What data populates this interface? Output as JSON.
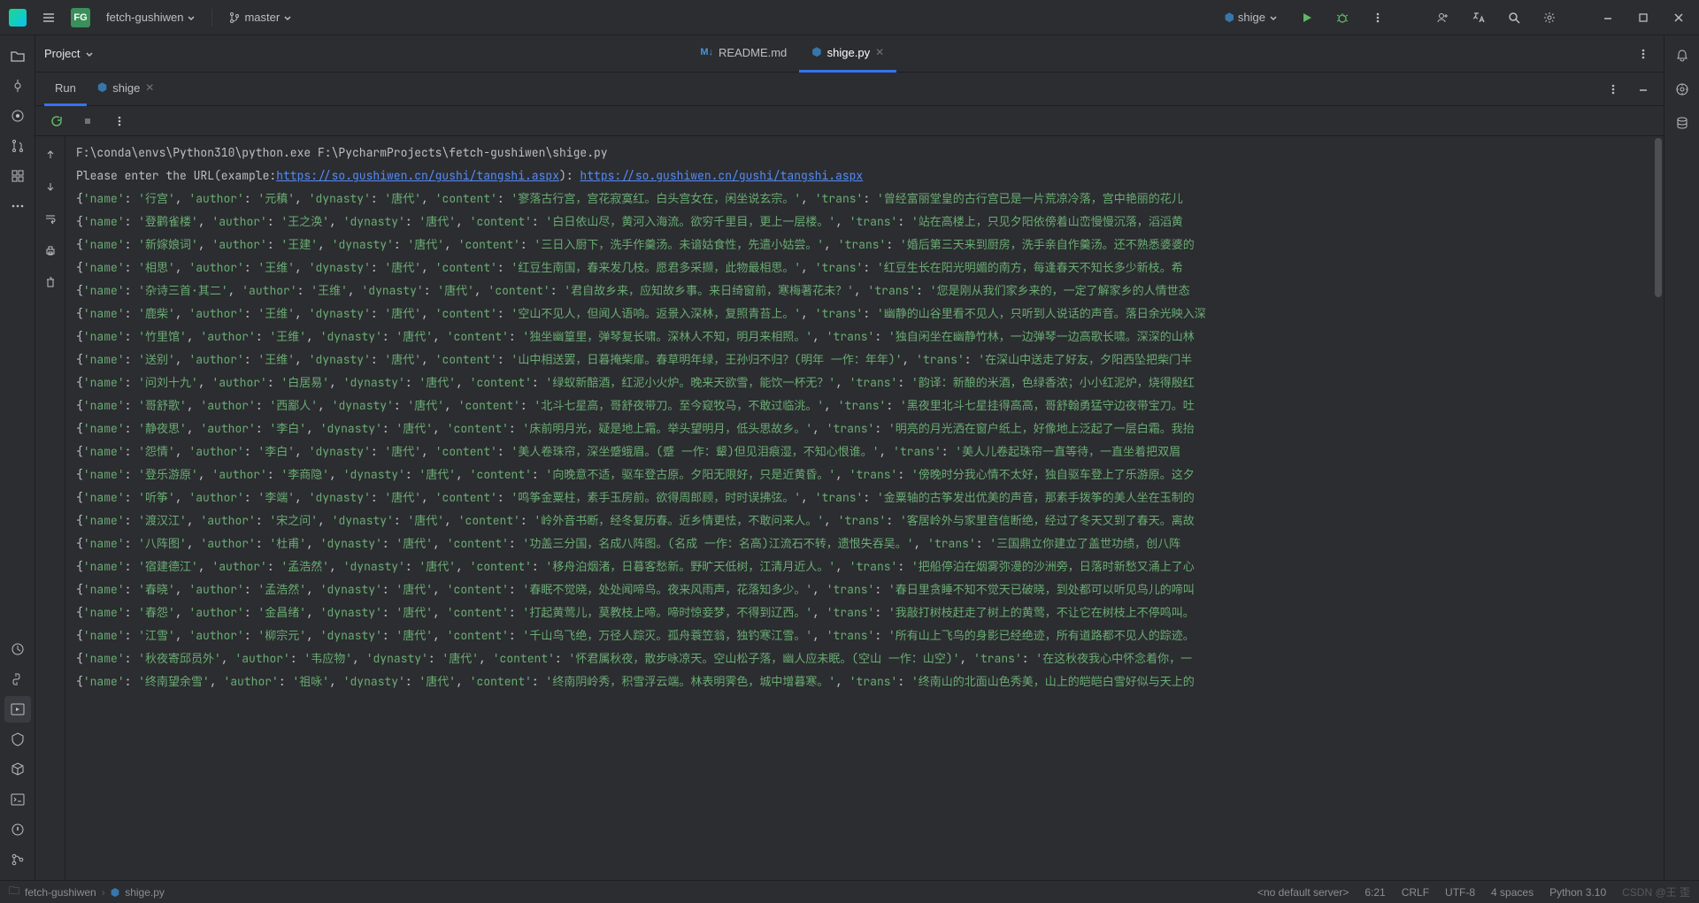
{
  "titlebar": {
    "project_badge": "FG",
    "project_name": "fetch-gushiwen",
    "branch": "master",
    "run_config": "shige"
  },
  "project_panel_label": "Project",
  "tabs": [
    {
      "label": "README.md",
      "icon": "md"
    },
    {
      "label": "shige.py",
      "icon": "py",
      "active": true
    }
  ],
  "run_tab": {
    "label": "Run",
    "config": "shige"
  },
  "console": {
    "exec_line": "F:\\conda\\envs\\Python310\\python.exe F:\\PycharmProjects\\fetch-gushiwen\\shige.py",
    "prompt_prefix": "Please enter the URL(example:",
    "example_url": "https://so.gushiwen.cn/gushi/tangshi.aspx",
    "prompt_suffix": "): ",
    "entered_url": "https://so.gushiwen.cn/gushi/tangshi.aspx",
    "rows": [
      {
        "name": "行宫",
        "author": "元稹",
        "dynasty": "唐代",
        "content": "寥落古行宫，宫花寂寞红。白头宫女在，闲坐说玄宗。",
        "trans": "曾经富丽堂皇的古行宫已是一片荒凉冷落，宫中艳丽的花儿"
      },
      {
        "name": "登鹳雀楼",
        "author": "王之涣",
        "dynasty": "唐代",
        "content": "白日依山尽，黄河入海流。欲穷千里目，更上一层楼。",
        "trans": "站在高楼上，只见夕阳依傍着山峦慢慢沉落，滔滔黄"
      },
      {
        "name": "新嫁娘词",
        "author": "王建",
        "dynasty": "唐代",
        "content": "三日入厨下，洗手作羹汤。未谙姑食性，先遣小姑尝。",
        "trans": "婚后第三天来到厨房，洗手亲自作羹汤。还不熟悉婆婆的"
      },
      {
        "name": "相思",
        "author": "王维",
        "dynasty": "唐代",
        "content": "红豆生南国，春来发几枝。愿君多采撷，此物最相思。",
        "trans": "红豆生长在阳光明媚的南方，每逢春天不知长多少新枝。希"
      },
      {
        "name": "杂诗三首·其二",
        "author": "王维",
        "dynasty": "唐代",
        "content": "君自故乡来，应知故乡事。来日绮窗前，寒梅著花未？",
        "trans": "您是刚从我们家乡来的，一定了解家乡的人情世态"
      },
      {
        "name": "鹿柴",
        "author": "王维",
        "dynasty": "唐代",
        "content": "空山不见人，但闻人语响。返景入深林，复照青苔上。",
        "trans": "幽静的山谷里看不见人，只听到人说话的声音。落日余光映入深"
      },
      {
        "name": "竹里馆",
        "author": "王维",
        "dynasty": "唐代",
        "content": "独坐幽篁里，弹琴复长啸。深林人不知，明月来相照。",
        "trans": "独自闲坐在幽静竹林，一边弹琴一边高歌长啸。深深的山林"
      },
      {
        "name": "送别",
        "author": "王维",
        "dynasty": "唐代",
        "content": "山中相送罢，日暮掩柴扉。春草明年绿，王孙归不归？(明年 一作：年年)",
        "trans": "在深山中送走了好友，夕阳西坠把柴门半"
      },
      {
        "name": "问刘十九",
        "author": "白居易",
        "dynasty": "唐代",
        "content": "绿蚁新醅酒，红泥小火炉。晚来天欲雪，能饮一杯无？",
        "trans": "韵译：新酿的米酒，色绿香浓；小小红泥炉，烧得殷红"
      },
      {
        "name": "哥舒歌",
        "author": "西鄙人",
        "dynasty": "唐代",
        "content": "北斗七星高，哥舒夜带刀。至今窥牧马，不敢过临洮。",
        "trans": "黑夜里北斗七星挂得高高，哥舒翰勇猛守边夜带宝刀。吐"
      },
      {
        "name": "静夜思",
        "author": "李白",
        "dynasty": "唐代",
        "content": "床前明月光，疑是地上霜。举头望明月，低头思故乡。",
        "trans": "明亮的月光洒在窗户纸上，好像地上泛起了一层白霜。我抬"
      },
      {
        "name": "怨情",
        "author": "李白",
        "dynasty": "唐代",
        "content": "美人卷珠帘，深坐蹙蛾眉。(蹙 一作：颦)但见泪痕湿，不知心恨谁。",
        "trans": "美人儿卷起珠帘一直等待，一直坐着把双眉"
      },
      {
        "name": "登乐游原",
        "author": "李商隐",
        "dynasty": "唐代",
        "content": "向晚意不适，驱车登古原。夕阳无限好，只是近黄昏。",
        "trans": "傍晚时分我心情不太好，独自驱车登上了乐游原。这夕"
      },
      {
        "name": "听筝",
        "author": "李端",
        "dynasty": "唐代",
        "content": "鸣筝金粟柱，素手玉房前。欲得周郎顾，时时误拂弦。",
        "trans": "金粟轴的古筝发出优美的声音，那素手拨筝的美人坐在玉制的"
      },
      {
        "name": "渡汉江",
        "author": "宋之问",
        "dynasty": "唐代",
        "content": "岭外音书断，经冬复历春。近乡情更怯，不敢问来人。",
        "trans": "客居岭外与家里音信断绝，经过了冬天又到了春天。离故"
      },
      {
        "name": "八阵图",
        "author": "杜甫",
        "dynasty": "唐代",
        "content": "功盖三分国，名成八阵图。(名成 一作：名高)江流石不转，遗恨失吞吴。",
        "trans": "三国鼎立你建立了盖世功绩，创八阵"
      },
      {
        "name": "宿建德江",
        "author": "孟浩然",
        "dynasty": "唐代",
        "content": "移舟泊烟渚，日暮客愁新。野旷天低树，江清月近人。",
        "trans": "把船停泊在烟雾弥漫的沙洲旁，日落时新愁又涌上了心"
      },
      {
        "name": "春晓",
        "author": "孟浩然",
        "dynasty": "唐代",
        "content": "春眠不觉晓，处处闻啼鸟。夜来风雨声，花落知多少。",
        "trans": "春日里贪睡不知不觉天已破晓，到处都可以听见鸟儿的啼叫"
      },
      {
        "name": "春怨",
        "author": "金昌绪",
        "dynasty": "唐代",
        "content": "打起黄莺儿，莫教枝上啼。啼时惊妾梦，不得到辽西。",
        "trans": "我敲打树枝赶走了树上的黄莺，不让它在树枝上不停鸣叫。"
      },
      {
        "name": "江雪",
        "author": "柳宗元",
        "dynasty": "唐代",
        "content": "千山鸟飞绝，万径人踪灭。孤舟蓑笠翁，独钓寒江雪。",
        "trans": "所有山上飞鸟的身影已经绝迹，所有道路都不见人的踪迹。"
      },
      {
        "name": "秋夜寄邱员外",
        "author": "韦应物",
        "dynasty": "唐代",
        "content": "怀君属秋夜，散步咏凉天。空山松子落，幽人应未眠。(空山 一作：山空)",
        "trans": "在这秋夜我心中怀念着你，一"
      },
      {
        "name": "终南望余雪",
        "author": "祖咏",
        "dynasty": "唐代",
        "content": "终南阴岭秀，积雪浮云端。林表明霁色，城中增暮寒。",
        "trans": "终南山的北面山色秀美，山上的皑皑白雪好似与天上的"
      }
    ]
  },
  "breadcrumb": {
    "folder": "fetch-gushiwen",
    "file": "shige.py"
  },
  "status": {
    "server": "<no default server>",
    "line_endings": "CRLF",
    "encoding": "UTF-8",
    "indent": "4 spaces",
    "python": "Python 3.10",
    "cursor": "6:21"
  },
  "watermark": "CSDN @王 歪"
}
